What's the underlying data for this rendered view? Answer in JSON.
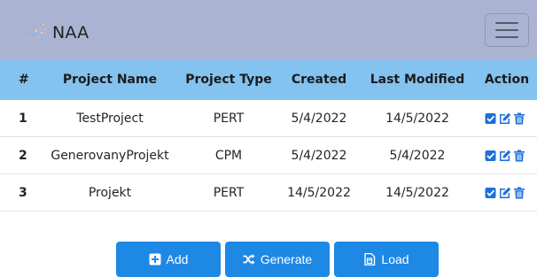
{
  "navbar": {
    "brand_name": "NAA",
    "toggler_icon": "hamburger-menu-icon"
  },
  "table": {
    "headers": [
      "#",
      "Project Name",
      "Project Type",
      "Created",
      "Last Modified",
      "Action"
    ],
    "rows": [
      {
        "num": "1",
        "name": "TestProject",
        "type": "PERT",
        "created": "5/4/2022",
        "modified": "14/5/2022"
      },
      {
        "num": "2",
        "name": "GenerovanyProjekt",
        "type": "CPM",
        "created": "5/4/2022",
        "modified": "5/4/2022"
      },
      {
        "num": "3",
        "name": "Projekt",
        "type": "PERT",
        "created": "14/5/2022",
        "modified": "14/5/2022"
      }
    ],
    "action_icons": [
      "check-square-icon",
      "edit-icon",
      "trash-icon"
    ]
  },
  "buttons": {
    "add_label": "Add",
    "generate_label": "Generate",
    "load_label": "Load"
  },
  "colors": {
    "navbar_bg": "#aab4d2",
    "header_bg": "#84c2ef",
    "button_bg": "#1e88e5",
    "action_icon": "#1e6fd9"
  }
}
